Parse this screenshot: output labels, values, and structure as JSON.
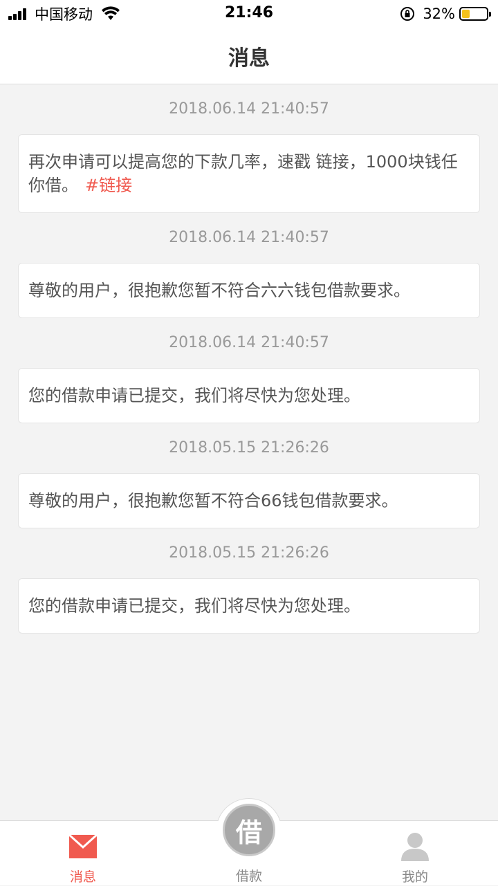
{
  "status_bar": {
    "carrier": "中国移动",
    "time": "21:46",
    "battery_percent": "32%",
    "battery_level": 0.32
  },
  "nav": {
    "title": "消息"
  },
  "messages": [
    {
      "time": "2018.06.14 21:40:57",
      "text": "再次申请可以提高您的下款几率，速戳 链接，1000块钱任你借。",
      "link": "#链接"
    },
    {
      "time": "2018.06.14 21:40:57",
      "text": "尊敬的用户，很抱歉您暂不符合六六钱包借款要求。"
    },
    {
      "time": "2018.06.14 21:40:57",
      "text": "您的借款申请已提交，我们将尽快为您处理。"
    },
    {
      "time": "2018.05.15 21:26:26",
      "text": "尊敬的用户，很抱歉您暂不符合66钱包借款要求。"
    },
    {
      "time": "2018.05.15 21:26:26",
      "text": "您的借款申请已提交，我们将尽快为您处理。"
    }
  ],
  "tab_bar": {
    "tabs": [
      {
        "label": "消息",
        "icon": "mail-icon",
        "active": true
      },
      {
        "label": "借款",
        "icon": "borrow-icon",
        "active": false
      },
      {
        "label": "我的",
        "icon": "user-icon",
        "active": false
      }
    ],
    "center_glyph": "借"
  },
  "colors": {
    "accent": "#f05a4f",
    "inactive": "#888888",
    "background": "#f3f3f3"
  }
}
